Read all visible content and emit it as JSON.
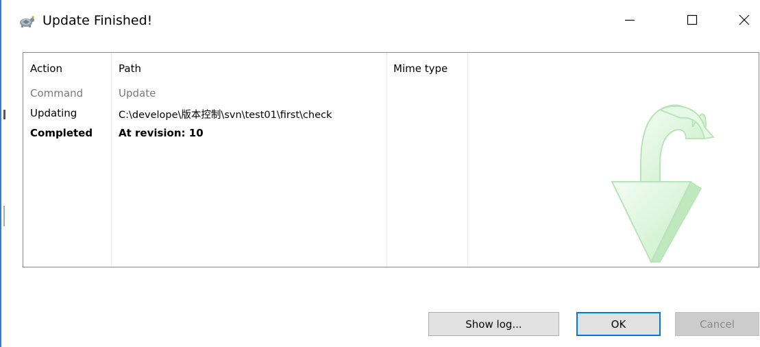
{
  "window": {
    "title": "Update Finished!"
  },
  "columns": [
    {
      "label": "Action"
    },
    {
      "label": "Path"
    },
    {
      "label": "Mime type"
    }
  ],
  "rows": [
    {
      "action": "Command",
      "path": "Update",
      "style": "gray"
    },
    {
      "action": "Updating",
      "path": "C:\\develope\\版本控制\\svn\\test01\\first\\check",
      "style": "normal"
    },
    {
      "action": "Completed",
      "path": "At revision: 10",
      "style": "bold"
    }
  ],
  "buttons": {
    "show_log": "Show log...",
    "ok": "OK",
    "cancel": "Cancel"
  },
  "icons": {
    "app": "tortoise-svn-icon",
    "minimize": "minimize-icon",
    "maximize": "maximize-icon",
    "close": "close-icon",
    "watermark": "update-arrow-icon"
  },
  "colors": {
    "ok_border": "#0078d7",
    "arrow_fill": "#d8f5d8",
    "arrow_edge": "#a8e0a8"
  }
}
